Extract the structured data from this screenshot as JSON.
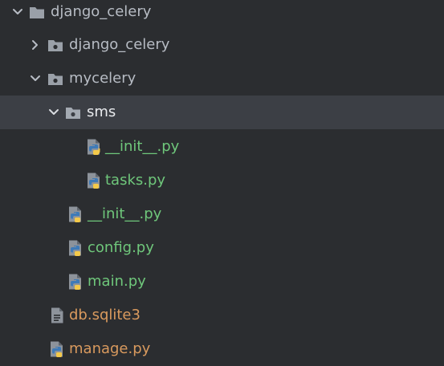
{
  "theme": {
    "background": "#2b2d30",
    "selected_row": "#3c3f45",
    "folder_color": "#9aa0a8",
    "python_blue": "#3e7ab8",
    "python_yellow": "#f4c94a",
    "file_color": "#8d939b"
  },
  "tree": {
    "items": [
      {
        "label": "django_celery",
        "type": "folder",
        "expanded": true,
        "depth": 0
      },
      {
        "label": "django_celery",
        "type": "package",
        "expanded": false,
        "depth": 1
      },
      {
        "label": "mycelery",
        "type": "package",
        "expanded": true,
        "depth": 1
      },
      {
        "label": "sms",
        "type": "package",
        "expanded": true,
        "depth": 2,
        "selected": true
      },
      {
        "label": "__init__.py",
        "type": "python",
        "depth": 3
      },
      {
        "label": "tasks.py",
        "type": "python",
        "depth": 3
      },
      {
        "label": "__init__.py",
        "type": "python",
        "depth": 2
      },
      {
        "label": "config.py",
        "type": "python",
        "depth": 2
      },
      {
        "label": "main.py",
        "type": "python",
        "depth": 2
      },
      {
        "label": "db.sqlite3",
        "type": "file",
        "depth": 1
      },
      {
        "label": "manage.py",
        "type": "python",
        "depth": 1
      }
    ]
  }
}
